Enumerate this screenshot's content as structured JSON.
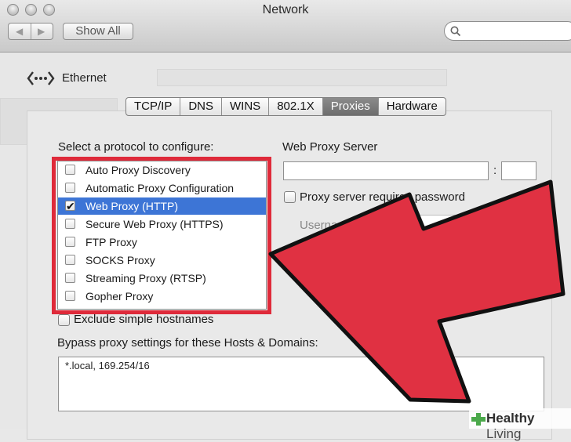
{
  "window": {
    "title": "Network"
  },
  "toolbar": {
    "show_all_label": "Show All",
    "search_placeholder": ""
  },
  "sidebar": {
    "interface_label": "Ethernet"
  },
  "tabs": [
    "TCP/IP",
    "DNS",
    "WINS",
    "802.1X",
    "Proxies",
    "Hardware"
  ],
  "active_tab": "Proxies",
  "proxies": {
    "select_label": "Select a protocol to configure:",
    "protocols": [
      {
        "label": "Auto Proxy Discovery",
        "checked": false,
        "selected": false
      },
      {
        "label": "Automatic Proxy Configuration",
        "checked": false,
        "selected": false
      },
      {
        "label": "Web Proxy (HTTP)",
        "checked": true,
        "selected": true
      },
      {
        "label": "Secure Web Proxy (HTTPS)",
        "checked": false,
        "selected": false
      },
      {
        "label": "FTP Proxy",
        "checked": false,
        "selected": false
      },
      {
        "label": "SOCKS Proxy",
        "checked": false,
        "selected": false
      },
      {
        "label": "Streaming Proxy (RTSP)",
        "checked": false,
        "selected": false
      },
      {
        "label": "Gopher Proxy",
        "checked": false,
        "selected": false
      }
    ],
    "server_heading": "Web Proxy Server",
    "server_value": "",
    "port_separator": ":",
    "port_value": "",
    "requires_password_label": "Proxy server requires password",
    "username_label": "Username:",
    "username_value": "",
    "password_value": "",
    "exclude_label": "Exclude simple hostnames",
    "bypass_label": "Bypass proxy settings for these Hosts & Domains:",
    "bypass_value": "*.local, 169.254/16"
  },
  "watermark": {
    "brand_bold": "Healthy",
    "brand_rest": " Living"
  },
  "colors": {
    "highlight": "#df2a3a",
    "selection": "#3d75d6",
    "arrow_fill": "#e03142"
  }
}
